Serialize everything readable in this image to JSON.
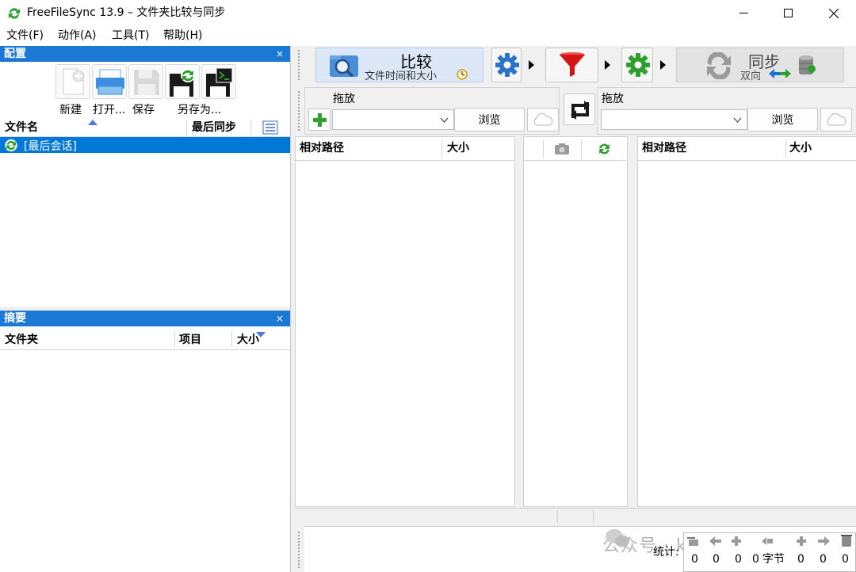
{
  "window": {
    "title": "FreeFileSync 13.9 – 文件夹比较与同步",
    "minimize_glyph": "—",
    "maximize_glyph": "☐",
    "close_glyph": "✕"
  },
  "menu": [
    {
      "label": "文件(F)"
    },
    {
      "label": "动作(A)"
    },
    {
      "label": "工具(T)"
    },
    {
      "label": "帮助(H)"
    }
  ],
  "config_panel": {
    "title": "配置",
    "close": "×",
    "buttons": [
      {
        "label": "新建",
        "icon": "new-file-icon"
      },
      {
        "label": "打开...",
        "icon": "open-printer-icon"
      },
      {
        "label": "保存",
        "icon": "save-disk-icon"
      },
      {
        "label": "另存为...",
        "icon": "save-as-disk-icon"
      }
    ],
    "columns": {
      "name": "文件名",
      "last_sync": "最后同步"
    },
    "rows": [
      {
        "label": "[最后会话]",
        "selected": true
      }
    ]
  },
  "summary_panel": {
    "title": "摘要",
    "close": "×",
    "columns": {
      "folder": "文件夹",
      "items": "项目",
      "size": "大小"
    }
  },
  "toolbar": {
    "compare": {
      "title": "比较",
      "subtitle": "文件时间和大小"
    },
    "sync": {
      "title": "同步",
      "subtitle": "双向"
    }
  },
  "left_folder": {
    "drop_label": "拖放",
    "browse": "浏览",
    "value": ""
  },
  "right_folder": {
    "drop_label": "拖放",
    "browse": "浏览",
    "value": ""
  },
  "grid": {
    "left_columns": {
      "path": "相对路径",
      "size": "大小"
    },
    "right_columns": {
      "path": "相对路径",
      "size": "大小"
    }
  },
  "stats": {
    "label": "统计:",
    "values": [
      "0",
      "0",
      "0",
      "0",
      "0",
      "0",
      "0"
    ],
    "bytes_unit": "字节"
  },
  "watermark": "公众号 · kali笔记",
  "colors": {
    "panel_header": "#1b78d5",
    "selection": "#0078d7",
    "sync_green": "#2e9e2e",
    "filter_red": "#d41414"
  }
}
